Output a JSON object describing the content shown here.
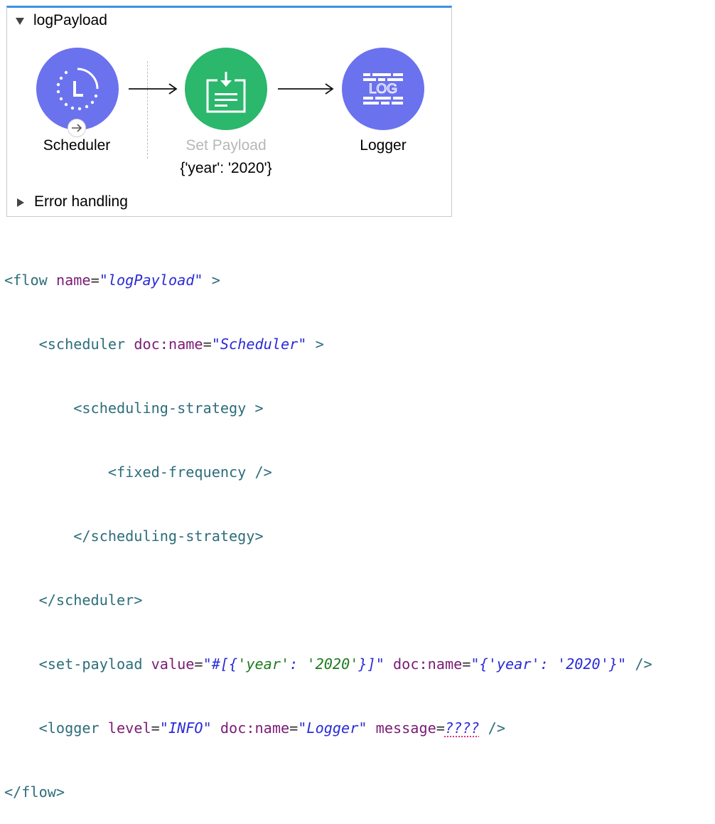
{
  "flow": {
    "title": "logPayload",
    "error_handling_label": "Error handling",
    "nodes": [
      {
        "label": "Scheduler",
        "icon": "clock-icon"
      },
      {
        "label": "Set Payload",
        "sublabel": "{'year': '2020'}",
        "icon": "set-payload-icon"
      },
      {
        "label": "Logger",
        "icon": "log-icon",
        "icon_text": "LOG"
      }
    ],
    "colors": {
      "scheduler": "#6b72ee",
      "set_payload": "#2bb76c",
      "logger": "#6b72ee",
      "accent": "#3f90e0"
    }
  },
  "code": {
    "l1": {
      "open": "<flow ",
      "attr": "name",
      "eq": "=",
      "val": "\"logPayload\"",
      "close": " >"
    },
    "l2": {
      "indent": "    ",
      "open": "<scheduler ",
      "attr": "doc:name",
      "eq": "=",
      "val": "\"Scheduler\"",
      "close": " >"
    },
    "l3": {
      "indent": "        ",
      "text": "<scheduling-strategy >"
    },
    "l4": {
      "indent": "            ",
      "text": "<fixed-frequency />"
    },
    "l5": {
      "indent": "        ",
      "text": "</scheduling-strategy>"
    },
    "l6": {
      "indent": "    ",
      "text": "</scheduler>"
    },
    "l7": {
      "indent": "    ",
      "open": "<set-payload ",
      "attr1": "value",
      "eq": "=",
      "v1a": "\"#[{",
      "v1b": "'year'",
      "v1c": ": ",
      "v1d": "'2020'",
      "v1e": "}]\"",
      "sp": " ",
      "attr2": "doc:name",
      "v2a": "\"{'year': '2020'}\"",
      "close": " />"
    },
    "l8": {
      "indent": "    ",
      "open": "<logger ",
      "attr1": "level",
      "eq": "=",
      "v1": "\"INFO\"",
      "sp": " ",
      "attr2": "doc:name",
      "v2": "\"Logger\"",
      "attr3": "message",
      "v3": "????",
      "close": " />"
    },
    "l9": {
      "text": "</flow>"
    }
  }
}
